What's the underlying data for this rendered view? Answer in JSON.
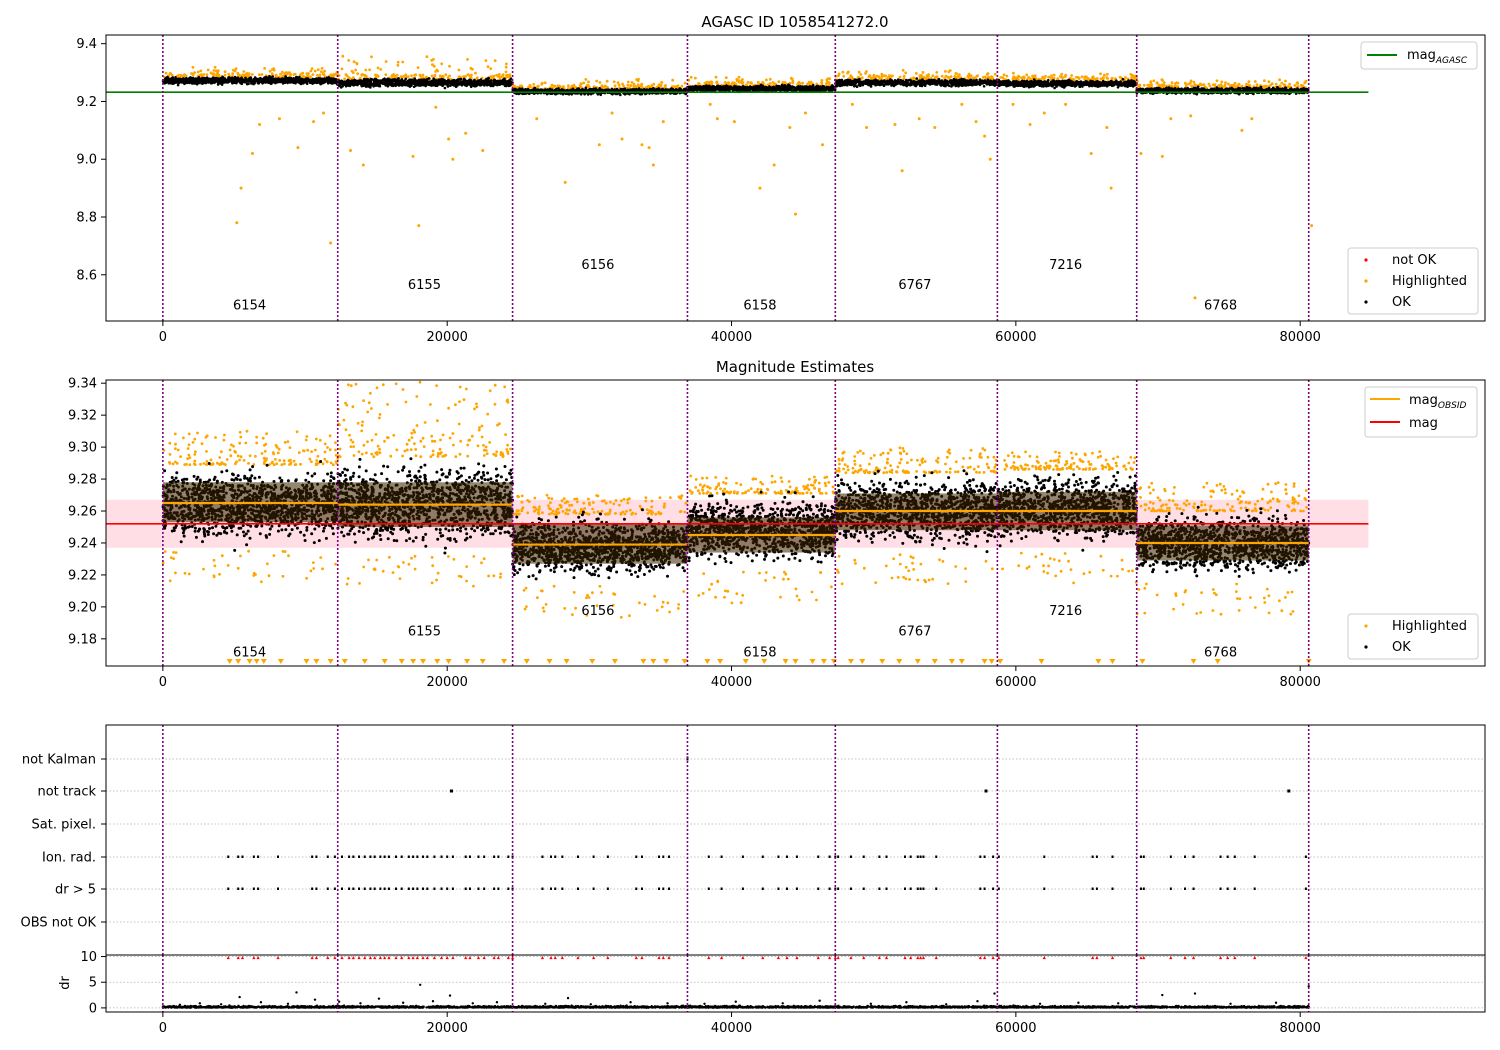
{
  "colors": {
    "ok": "#000000",
    "highlighted": "#ffa500",
    "not_ok": "#ff0000",
    "mag_agasc": "#008000",
    "mag": "#ff0000",
    "mag_obsid": "#ffa500",
    "obsid_boundary": "#800080",
    "band": "#ffc0cb"
  },
  "chart_data": [
    {
      "type": "scatter",
      "title": "AGASC ID 1058541272.0",
      "xlim": [
        -4000,
        93000
      ],
      "ylim": [
        8.44,
        9.43
      ],
      "xticks": [
        0,
        20000,
        40000,
        60000,
        80000
      ],
      "yticks": [
        8.6,
        8.8,
        9.0,
        9.2,
        9.4
      ],
      "grid": false,
      "legend_upper": {
        "placement": "top-right",
        "entries": [
          {
            "label": "mag",
            "subscript": "AGASC",
            "kind": "line",
            "color": "#008000"
          }
        ]
      },
      "legend_lower": {
        "placement": "bottom-right",
        "entries": [
          {
            "label": "not OK",
            "kind": "point",
            "color": "#ff0000"
          },
          {
            "label": "Highlighted",
            "kind": "point",
            "color": "#ffa500"
          },
          {
            "label": "OK",
            "kind": "point",
            "color": "#000000"
          }
        ]
      },
      "mag_agasc": 9.232,
      "mag_agasc_x": [
        -4000,
        84800
      ],
      "obsid_boundaries": [
        0,
        12300,
        24600,
        36900,
        47300,
        58700,
        68500,
        80600
      ],
      "obsid_labels": [
        {
          "text": "6154",
          "x": 6100,
          "y": 8.48
        },
        {
          "text": "6155",
          "x": 18400,
          "y": 8.55
        },
        {
          "text": "6156",
          "x": 30600,
          "y": 8.62
        },
        {
          "text": "6158",
          "x": 42000,
          "y": 8.48
        },
        {
          "text": "6767",
          "x": 52900,
          "y": 8.55
        },
        {
          "text": "7216",
          "x": 63500,
          "y": 8.62
        },
        {
          "text": "6768",
          "x": 74400,
          "y": 8.48
        }
      ],
      "segments": [
        {
          "x": [
            0,
            12300
          ],
          "center": 9.272,
          "spread": 0.014,
          "hl_top": 9.31
        },
        {
          "x": [
            12300,
            24600
          ],
          "center": 9.265,
          "spread": 0.016,
          "hl_top": 9.35
        },
        {
          "x": [
            24600,
            36900
          ],
          "center": 9.235,
          "spread": 0.012,
          "hl_top": 9.27
        },
        {
          "x": [
            36900,
            47300
          ],
          "center": 9.245,
          "spread": 0.012,
          "hl_top": 9.28
        },
        {
          "x": [
            47300,
            58700
          ],
          "center": 9.265,
          "spread": 0.014,
          "hl_top": 9.3
        },
        {
          "x": [
            58700,
            68500
          ],
          "center": 9.262,
          "spread": 0.013,
          "hl_top": 9.29
        },
        {
          "x": [
            68500,
            80600
          ],
          "center": 9.237,
          "spread": 0.012,
          "hl_top": 9.27
        }
      ],
      "outliers": [
        [
          5200,
          8.78
        ],
        [
          5500,
          8.9
        ],
        [
          6300,
          9.02
        ],
        [
          6800,
          9.12
        ],
        [
          8200,
          9.14
        ],
        [
          9500,
          9.04
        ],
        [
          10600,
          9.13
        ],
        [
          11300,
          9.16
        ],
        [
          11800,
          8.71
        ],
        [
          13200,
          9.03
        ],
        [
          14100,
          8.98
        ],
        [
          17600,
          9.01
        ],
        [
          18000,
          8.77
        ],
        [
          19200,
          9.18
        ],
        [
          20100,
          9.07
        ],
        [
          20400,
          9.0
        ],
        [
          21300,
          9.09
        ],
        [
          22500,
          9.03
        ],
        [
          26300,
          9.14
        ],
        [
          28300,
          8.92
        ],
        [
          30700,
          9.05
        ],
        [
          31600,
          9.16
        ],
        [
          32300,
          9.07
        ],
        [
          33700,
          9.05
        ],
        [
          34200,
          9.04
        ],
        [
          34500,
          8.98
        ],
        [
          35200,
          9.13
        ],
        [
          38500,
          9.19
        ],
        [
          39000,
          9.14
        ],
        [
          40200,
          9.13
        ],
        [
          42000,
          8.9
        ],
        [
          43000,
          8.98
        ],
        [
          44100,
          9.11
        ],
        [
          44500,
          8.81
        ],
        [
          45200,
          9.16
        ],
        [
          46400,
          9.05
        ],
        [
          48500,
          9.19
        ],
        [
          49500,
          9.11
        ],
        [
          51500,
          9.12
        ],
        [
          52000,
          8.96
        ],
        [
          53200,
          9.14
        ],
        [
          54300,
          9.11
        ],
        [
          56200,
          9.19
        ],
        [
          57200,
          9.13
        ],
        [
          57800,
          9.08
        ],
        [
          58200,
          9.0
        ],
        [
          59800,
          9.19
        ],
        [
          61000,
          9.12
        ],
        [
          62000,
          9.16
        ],
        [
          63500,
          9.19
        ],
        [
          65300,
          9.02
        ],
        [
          66400,
          9.11
        ],
        [
          66700,
          8.9
        ],
        [
          68800,
          9.02
        ],
        [
          70300,
          9.01
        ],
        [
          70900,
          9.14
        ],
        [
          72300,
          9.15
        ],
        [
          72600,
          8.52
        ],
        [
          75900,
          9.1
        ],
        [
          76600,
          9.14
        ],
        [
          80800,
          8.77
        ]
      ]
    },
    {
      "type": "scatter",
      "title": "Magnitude Estimates",
      "xlim": [
        -4000,
        93000
      ],
      "ylim": [
        9.163,
        9.342
      ],
      "xticks": [
        0,
        20000,
        40000,
        60000,
        80000
      ],
      "yticks": [
        9.18,
        9.2,
        9.22,
        9.24,
        9.26,
        9.28,
        9.3,
        9.32,
        9.34
      ],
      "grid": false,
      "legend_upper": {
        "placement": "top-right",
        "entries": [
          {
            "label": "mag",
            "subscript": "OBSID",
            "kind": "line",
            "color": "#ffa500"
          },
          {
            "label": "mag",
            "subscript": "",
            "kind": "line",
            "color": "#ff0000"
          }
        ]
      },
      "legend_lower": {
        "placement": "bottom-right",
        "entries": [
          {
            "label": "Highlighted",
            "kind": "point",
            "color": "#ffa500"
          },
          {
            "label": "OK",
            "kind": "point",
            "color": "#000000"
          }
        ]
      },
      "mag": 9.252,
      "mag_band": [
        9.237,
        9.267
      ],
      "mag_x": [
        -4000,
        84800
      ],
      "obsid_boundaries": [
        0,
        12300,
        24600,
        36900,
        47300,
        58700,
        68500,
        80600
      ],
      "obsid_labels": [
        {
          "text": "6154",
          "x": 6100,
          "y": 9.169
        },
        {
          "text": "6155",
          "x": 18400,
          "y": 9.182
        },
        {
          "text": "6156",
          "x": 30600,
          "y": 9.195
        },
        {
          "text": "6158",
          "x": 42000,
          "y": 9.169
        },
        {
          "text": "6767",
          "x": 52900,
          "y": 9.182
        },
        {
          "text": "7216",
          "x": 63500,
          "y": 9.195
        },
        {
          "text": "6768",
          "x": 74400,
          "y": 9.169
        }
      ],
      "segments": [
        {
          "x": [
            0,
            12300
          ],
          "mag_obsid": 9.265,
          "band": [
            9.253,
            9.278
          ],
          "lo": 9.235,
          "hi": 9.293,
          "hl_hi": 9.31
        },
        {
          "x": [
            12300,
            24600
          ],
          "mag_obsid": 9.264,
          "band": [
            9.25,
            9.278
          ],
          "lo": 9.232,
          "hi": 9.298,
          "hl_hi": 9.342
        },
        {
          "x": [
            24600,
            36900
          ],
          "mag_obsid": 9.239,
          "band": [
            9.227,
            9.252
          ],
          "lo": 9.213,
          "hi": 9.262,
          "hl_hi": 9.27
        },
        {
          "x": [
            36900,
            47300
          ],
          "mag_obsid": 9.245,
          "band": [
            9.234,
            9.256
          ],
          "lo": 9.222,
          "hi": 9.275,
          "hl_hi": 9.282
        },
        {
          "x": [
            47300,
            58700
          ],
          "mag_obsid": 9.26,
          "band": [
            9.248,
            9.271
          ],
          "lo": 9.233,
          "hi": 9.288,
          "hl_hi": 9.3
        },
        {
          "x": [
            58700,
            68500
          ],
          "mag_obsid": 9.26,
          "band": [
            9.248,
            9.272
          ],
          "lo": 9.234,
          "hi": 9.29,
          "hl_hi": 9.298
        },
        {
          "x": [
            68500,
            80600
          ],
          "mag_obsid": 9.24,
          "band": [
            9.229,
            9.251
          ],
          "lo": 9.215,
          "hi": 9.264,
          "hl_hi": 9.278
        }
      ],
      "low_markers": [
        4700,
        5300,
        6100,
        6600,
        7100,
        8300,
        10100,
        10800,
        11800,
        12800,
        14200,
        15600,
        16800,
        17600,
        18300,
        19300,
        20100,
        21400,
        22500,
        24000,
        25600,
        27200,
        28400,
        30200,
        31800,
        33800,
        34500,
        35400,
        36700,
        38300,
        39200,
        41000,
        42300,
        43800,
        44500,
        45700,
        46500,
        47200,
        48400,
        49200,
        50600,
        51800,
        53100,
        54300,
        55500,
        56200,
        57800,
        58300,
        58900,
        61800,
        65800,
        66800,
        68900,
        72500,
        74200,
        80600
      ]
    },
    {
      "type": "scatter",
      "title": "",
      "xlim": [
        -4000,
        93000
      ],
      "categories": [
        "not Kalman",
        "not track",
        "Sat. pixel.",
        "Ion. rad.",
        "dr > 5",
        "OBS not OK"
      ],
      "obsid_boundaries": [
        0,
        12300,
        24600,
        36900,
        47300,
        58700,
        68500,
        80600
      ],
      "flag_x": [
        4600,
        5300,
        5600,
        6400,
        6700,
        8100,
        10500,
        10800,
        11600,
        12100,
        12600,
        13100,
        13400,
        13800,
        14200,
        14600,
        14900,
        15300,
        15600,
        15900,
        16400,
        16800,
        17300,
        17600,
        17900,
        18300,
        18600,
        19100,
        19600,
        20000,
        20400,
        21300,
        21600,
        22200,
        22600,
        23300,
        23600,
        24300,
        24600,
        26700,
        27300,
        27600,
        28100,
        29200,
        30300,
        31300,
        33300,
        33700,
        34900,
        35200,
        35600,
        38400,
        39300,
        40800,
        42200,
        43300,
        43900,
        44600,
        46100,
        46900,
        47300,
        47500,
        48400,
        49300,
        50400,
        50900,
        52200,
        52600,
        53100,
        53300,
        53500,
        54400,
        57500,
        57800,
        58400,
        58800,
        62000,
        65400,
        65700,
        66800,
        68800,
        69000,
        70900,
        71900,
        72500,
        74400,
        74900,
        75400,
        76800,
        80400
      ],
      "not_track_x": [
        20300,
        57900,
        79200
      ],
      "not_kalman_x": [
        36900
      ]
    },
    {
      "type": "scatter",
      "title": "",
      "ylabel": "dr",
      "xlim": [
        -4000,
        93000
      ],
      "ylim": [
        -0.8,
        10.3
      ],
      "xticks": [
        0,
        20000,
        40000,
        60000,
        80000
      ],
      "yticks": [
        0,
        5,
        10
      ],
      "obsid_boundaries": [
        0,
        12300,
        24600,
        36900,
        47300,
        58700,
        68500,
        80600
      ],
      "red_markers_y": 9.8,
      "scatter_points": [
        [
          1200,
          0.6
        ],
        [
          2600,
          0.9
        ],
        [
          4100,
          0.7
        ],
        [
          5400,
          2.1
        ],
        [
          6900,
          1.1
        ],
        [
          8800,
          0.8
        ],
        [
          9400,
          3.0
        ],
        [
          10700,
          1.6
        ],
        [
          12400,
          1.2
        ],
        [
          13900,
          0.9
        ],
        [
          15200,
          1.8
        ],
        [
          16900,
          1.0
        ],
        [
          18100,
          4.5
        ],
        [
          19000,
          1.3
        ],
        [
          20200,
          2.4
        ],
        [
          21800,
          0.9
        ],
        [
          23500,
          1.1
        ],
        [
          26900,
          0.8
        ],
        [
          28500,
          1.9
        ],
        [
          30100,
          0.7
        ],
        [
          32900,
          1.1
        ],
        [
          35500,
          0.9
        ],
        [
          38100,
          0.8
        ],
        [
          40300,
          1.2
        ],
        [
          43600,
          0.9
        ],
        [
          46200,
          1.4
        ],
        [
          49800,
          0.8
        ],
        [
          52300,
          1.1
        ],
        [
          55100,
          0.7
        ],
        [
          57300,
          1.3
        ],
        [
          58500,
          2.8
        ],
        [
          61700,
          0.8
        ],
        [
          64400,
          1.0
        ],
        [
          67200,
          0.9
        ],
        [
          70300,
          2.5
        ],
        [
          72600,
          2.8
        ],
        [
          75100,
          0.8
        ],
        [
          78300,
          1.0
        ],
        [
          80600,
          4.2
        ]
      ]
    }
  ]
}
